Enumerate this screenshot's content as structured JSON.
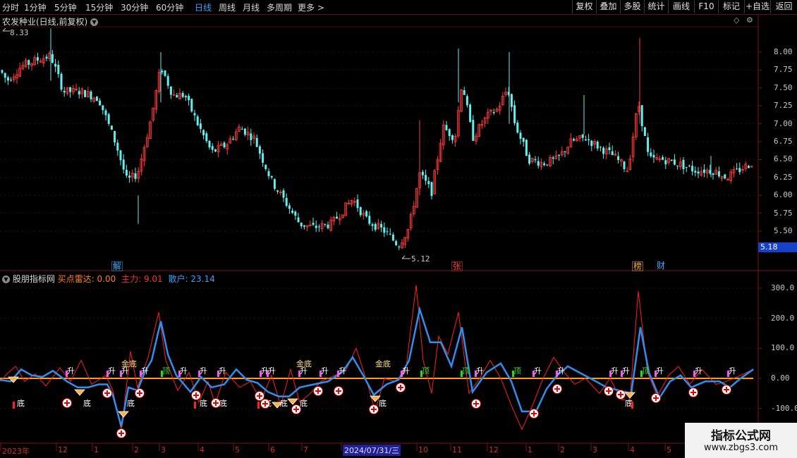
{
  "periods": [
    "分时",
    "1分钟",
    "5分钟",
    "15分钟",
    "30分钟",
    "60分钟",
    "日线",
    "周线",
    "月线",
    "多周期",
    "更多 >"
  ],
  "active_period": "日线",
  "right_buttons": [
    "复权",
    "叠加",
    "多股",
    "统计",
    "画线",
    "F10",
    "标记",
    "+自选",
    "返回"
  ],
  "stock_title": "农发种业(日线,前复权)",
  "main_axis_ticks": [
    "8.00",
    "7.75",
    "7.50",
    "7.25",
    "7.00",
    "6.75",
    "6.50",
    "6.25",
    "6.00",
    "5.75",
    "5.50"
  ],
  "current_price": "5.18",
  "high_label": "8.33",
  "low_label": "5.12",
  "events": [
    {
      "text": "解",
      "color": "#3ab0ff"
    },
    {
      "text": "张",
      "color": "#ff4040"
    },
    {
      "text": "榜",
      "color": "#ffb040"
    },
    {
      "text": "财",
      "color": "#3ab0ff"
    }
  ],
  "indicator": {
    "name": "股朋指标网",
    "items": [
      {
        "label": "买点雷达:",
        "value": "0.00",
        "color": "#ff8020"
      },
      {
        "label": "主力:",
        "value": "9.01",
        "color": "#ff3030"
      },
      {
        "label": "散户:",
        "value": "23.14",
        "color": "#3aa0ff"
      }
    ],
    "axis_ticks": [
      "300.0",
      "200.0",
      "100.0",
      "0.00",
      "-100.0"
    ]
  },
  "signals": {
    "sheng": "升",
    "ding": "顶",
    "di": "底",
    "jindi": "金底"
  },
  "date_axis": [
    "2023年",
    "12",
    "1",
    "2",
    "3",
    "4",
    "5",
    "6",
    "7",
    "2024/07/31/三",
    "10",
    "11",
    "12",
    "1",
    "2",
    "3",
    "4",
    "5"
  ],
  "watermark": {
    "title": "指标公式网",
    "url": "www.zbgs3.com"
  },
  "colors": {
    "up": "#ff3c3c",
    "down": "#5ff0f0",
    "fast": "#ff2020",
    "slow": "#2f8ff0",
    "zero": "#ff9a20"
  }
}
